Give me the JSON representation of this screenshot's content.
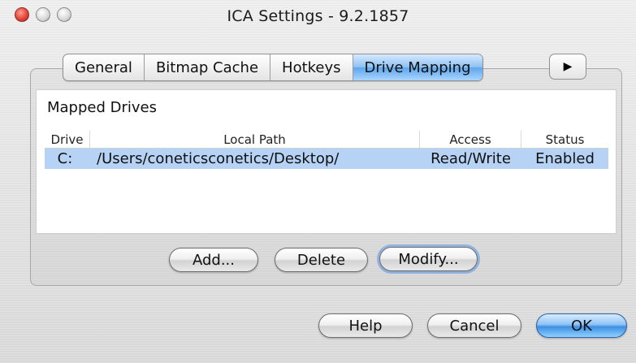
{
  "window": {
    "title": "ICA Settings - 9.2.1857"
  },
  "tabs": [
    {
      "label": "General"
    },
    {
      "label": "Bitmap Cache"
    },
    {
      "label": "Hotkeys"
    },
    {
      "label": "Drive Mapping"
    }
  ],
  "tab_more": {
    "glyph": "▶"
  },
  "mapped_drives": {
    "label": "Mapped Drives",
    "columns": [
      "Drive",
      "Local Path",
      "Access",
      "Status"
    ],
    "rows": [
      {
        "drive": "C:",
        "path": "/Users/coneticsconetics/Desktop/",
        "access": "Read/Write",
        "status": "Enabled"
      }
    ]
  },
  "drive_buttons": {
    "add": "Add...",
    "delete": "Delete",
    "modify": "Modify..."
  },
  "dialog_buttons": {
    "help": "Help",
    "cancel": "Cancel",
    "ok": "OK"
  },
  "colors": {
    "selection": "#b6d2f5",
    "accent": "#5ea6ec",
    "close_light": "#e2453a"
  },
  "icons": {
    "traffic_close": "close-icon",
    "traffic_min": "minimize-icon",
    "traffic_max": "zoom-icon",
    "more_tabs": "triangle-right-icon"
  }
}
